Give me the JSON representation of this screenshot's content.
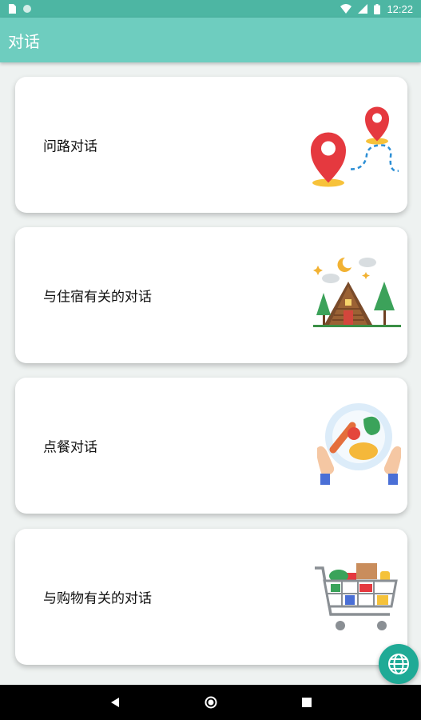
{
  "status_bar": {
    "time": "12:22",
    "left_icons": [
      "sim-card-icon",
      "circle-notification-icon"
    ],
    "right_icons": [
      "wifi-icon",
      "signal-icon",
      "battery-icon"
    ]
  },
  "app_bar": {
    "title": "对话"
  },
  "cards": [
    {
      "label": "问路对话",
      "icon": "map-pins-icon"
    },
    {
      "label": "与住宿有关的对话",
      "icon": "cabin-icon"
    },
    {
      "label": "点餐对话",
      "icon": "food-plate-icon"
    },
    {
      "label": "与购物有关的对话",
      "icon": "shopping-cart-icon"
    }
  ],
  "fab": {
    "icon": "globe-icon",
    "color": "#1faa96"
  },
  "nav_bar": {
    "buttons": [
      "back-icon",
      "home-icon",
      "recents-icon"
    ]
  },
  "colors": {
    "status_bar": "#4db6a3",
    "app_bar": "#6ecdbf",
    "accent": "#1faa96",
    "background": "#eef2f1"
  }
}
